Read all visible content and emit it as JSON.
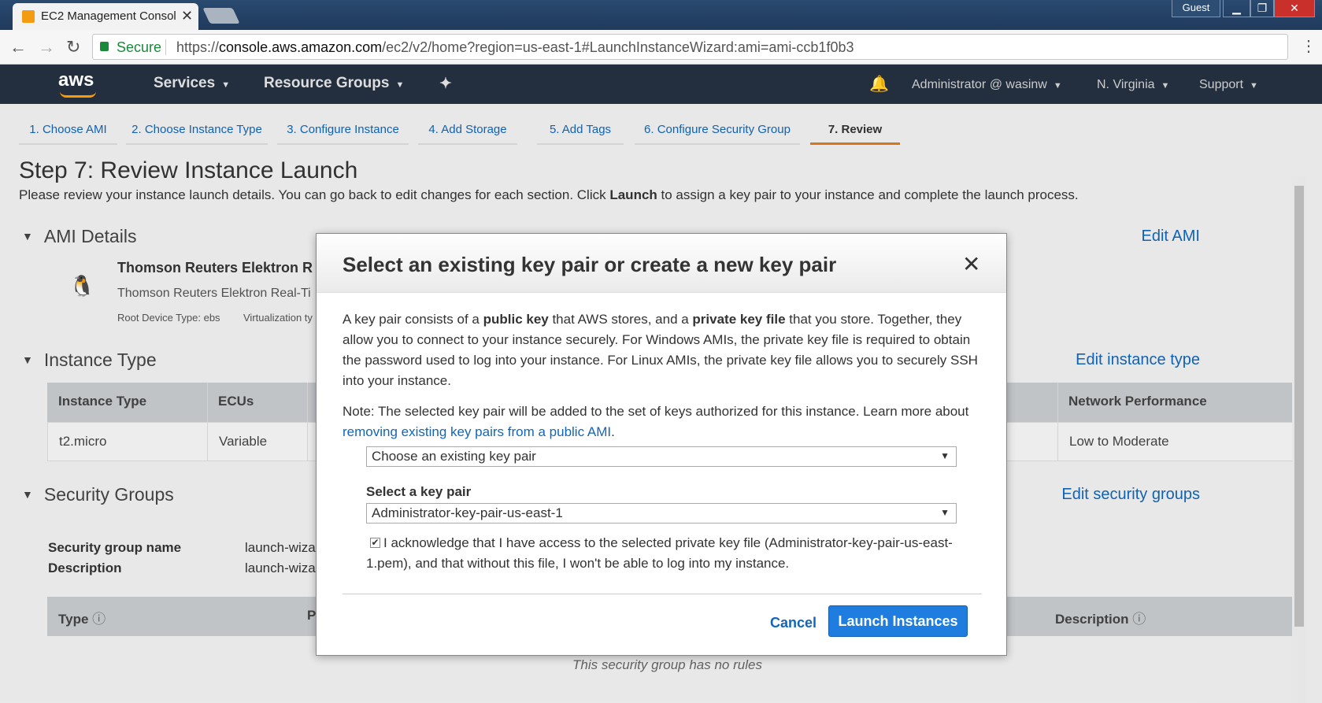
{
  "browser": {
    "tab_title": "EC2 Management Consol",
    "guest_label": "Guest",
    "secure_label": "Secure",
    "url_prefix": "https://",
    "url_host": "console.aws.amazon.com",
    "url_path": "/ec2/v2/home?region=us-east-1#LaunchInstanceWizard:ami=ami-ccb1f0b3"
  },
  "aws_nav": {
    "logo": "aws",
    "services": "Services",
    "resource_groups": "Resource Groups",
    "account": "Administrator @ wasinw",
    "region": "N. Virginia",
    "support": "Support"
  },
  "steps": [
    "1. Choose AMI",
    "2. Choose Instance Type",
    "3. Configure Instance",
    "4. Add Storage",
    "5. Add Tags",
    "6. Configure Security Group",
    "7. Review"
  ],
  "page": {
    "title": "Step 7: Review Instance Launch",
    "intro_before": "Please review your instance launch details. You can go back to edit changes for each section. Click ",
    "intro_bold": "Launch",
    "intro_after": " to assign a key pair to your instance and complete the launch process."
  },
  "ami": {
    "section": "AMI Details",
    "edit": "Edit AMI",
    "name": "Thomson Reuters Elektron R",
    "desc": "Thomson Reuters Elektron Real-Ti",
    "root_device": "Root Device Type: ebs",
    "virtualization": "Virtualization ty"
  },
  "instance_type": {
    "section": "Instance Type",
    "edit": "Edit instance type",
    "headers": [
      "Instance Type",
      "ECUs",
      "Network Performance"
    ],
    "row": [
      "t2.micro",
      "Variable",
      "Low to Moderate"
    ]
  },
  "security_groups": {
    "section": "Security Groups",
    "edit": "Edit security groups",
    "name_label": "Security group name",
    "name_value": "launch-wiza",
    "desc_label": "Description",
    "desc_value": "launch-wiza",
    "headers": [
      "Type",
      "P",
      "Description"
    ],
    "no_rules": "This security group has no rules"
  },
  "modal": {
    "title": "Select an existing key pair or create a new key pair",
    "p1_a": "A key pair consists of a ",
    "p1_b": "public key",
    "p1_c": " that AWS stores, and a ",
    "p1_d": "private key file",
    "p1_e": " that you store. Together, they allow you to connect to your instance securely. For Windows AMIs, the private key file is required to obtain the password used to log into your instance. For Linux AMIs, the private key file allows you to securely SSH into your instance.",
    "note_a": "Note: The selected key pair will be added to the set of keys authorized for this instance. Learn more about ",
    "note_link": "removing existing key pairs from a public AMI",
    "note_b": ".",
    "mode_select": "Choose an existing key pair",
    "keypair_label": "Select a key pair",
    "keypair_select": "Administrator-key-pair-us-east-1",
    "acknowledge": "I acknowledge that I have access to the selected private key file (Administrator-key-pair-us-east-1.pem), and that without this file, I won't be able to log into my instance.",
    "acknowledge_checked": true,
    "cancel": "Cancel",
    "launch": "Launch Instances"
  }
}
